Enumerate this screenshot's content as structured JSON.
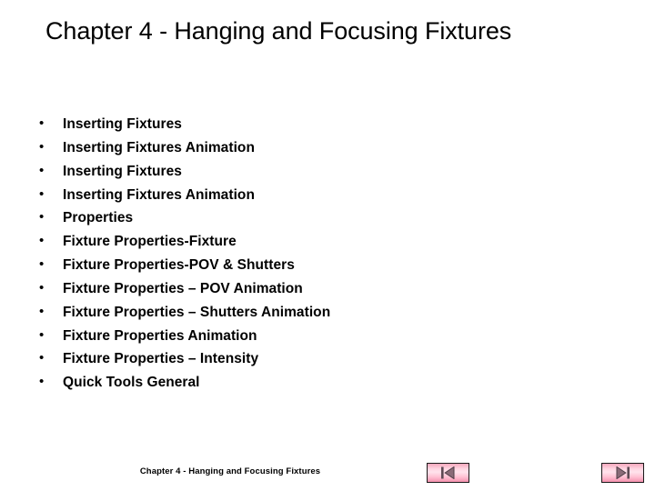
{
  "slide": {
    "title": "Chapter 4 - Hanging and Focusing Fixtures",
    "background_color": "#ffffff",
    "text_color": "#000000",
    "bullet_marker": "•",
    "bullets": [
      {
        "label": "Inserting Fixtures"
      },
      {
        "label": "Inserting Fixtures Animation"
      },
      {
        "label": "Inserting Fixtures"
      },
      {
        "label": "Inserting Fixtures Animation"
      },
      {
        "label": "Properties"
      },
      {
        "label": "Fixture Properties-Fixture"
      },
      {
        "label": "Fixture Properties-POV & Shutters"
      },
      {
        "label": "Fixture Properties – POV Animation"
      },
      {
        "label": "Fixture Properties – Shutters Animation"
      },
      {
        "label": "Fixture Properties Animation"
      },
      {
        "label": "Fixture Properties – Intensity"
      },
      {
        "label": "Quick Tools General"
      }
    ]
  },
  "footer": {
    "text": "Chapter 4 - Hanging and Focusing Fixtures"
  },
  "navigation": {
    "first_button": {
      "icon": "previous-slide-icon",
      "accent_color": "#f492ae",
      "glyph_color": "#6b5560"
    },
    "last_button": {
      "icon": "next-slide-icon",
      "accent_color": "#f492ae",
      "glyph_color": "#6b5560"
    }
  }
}
